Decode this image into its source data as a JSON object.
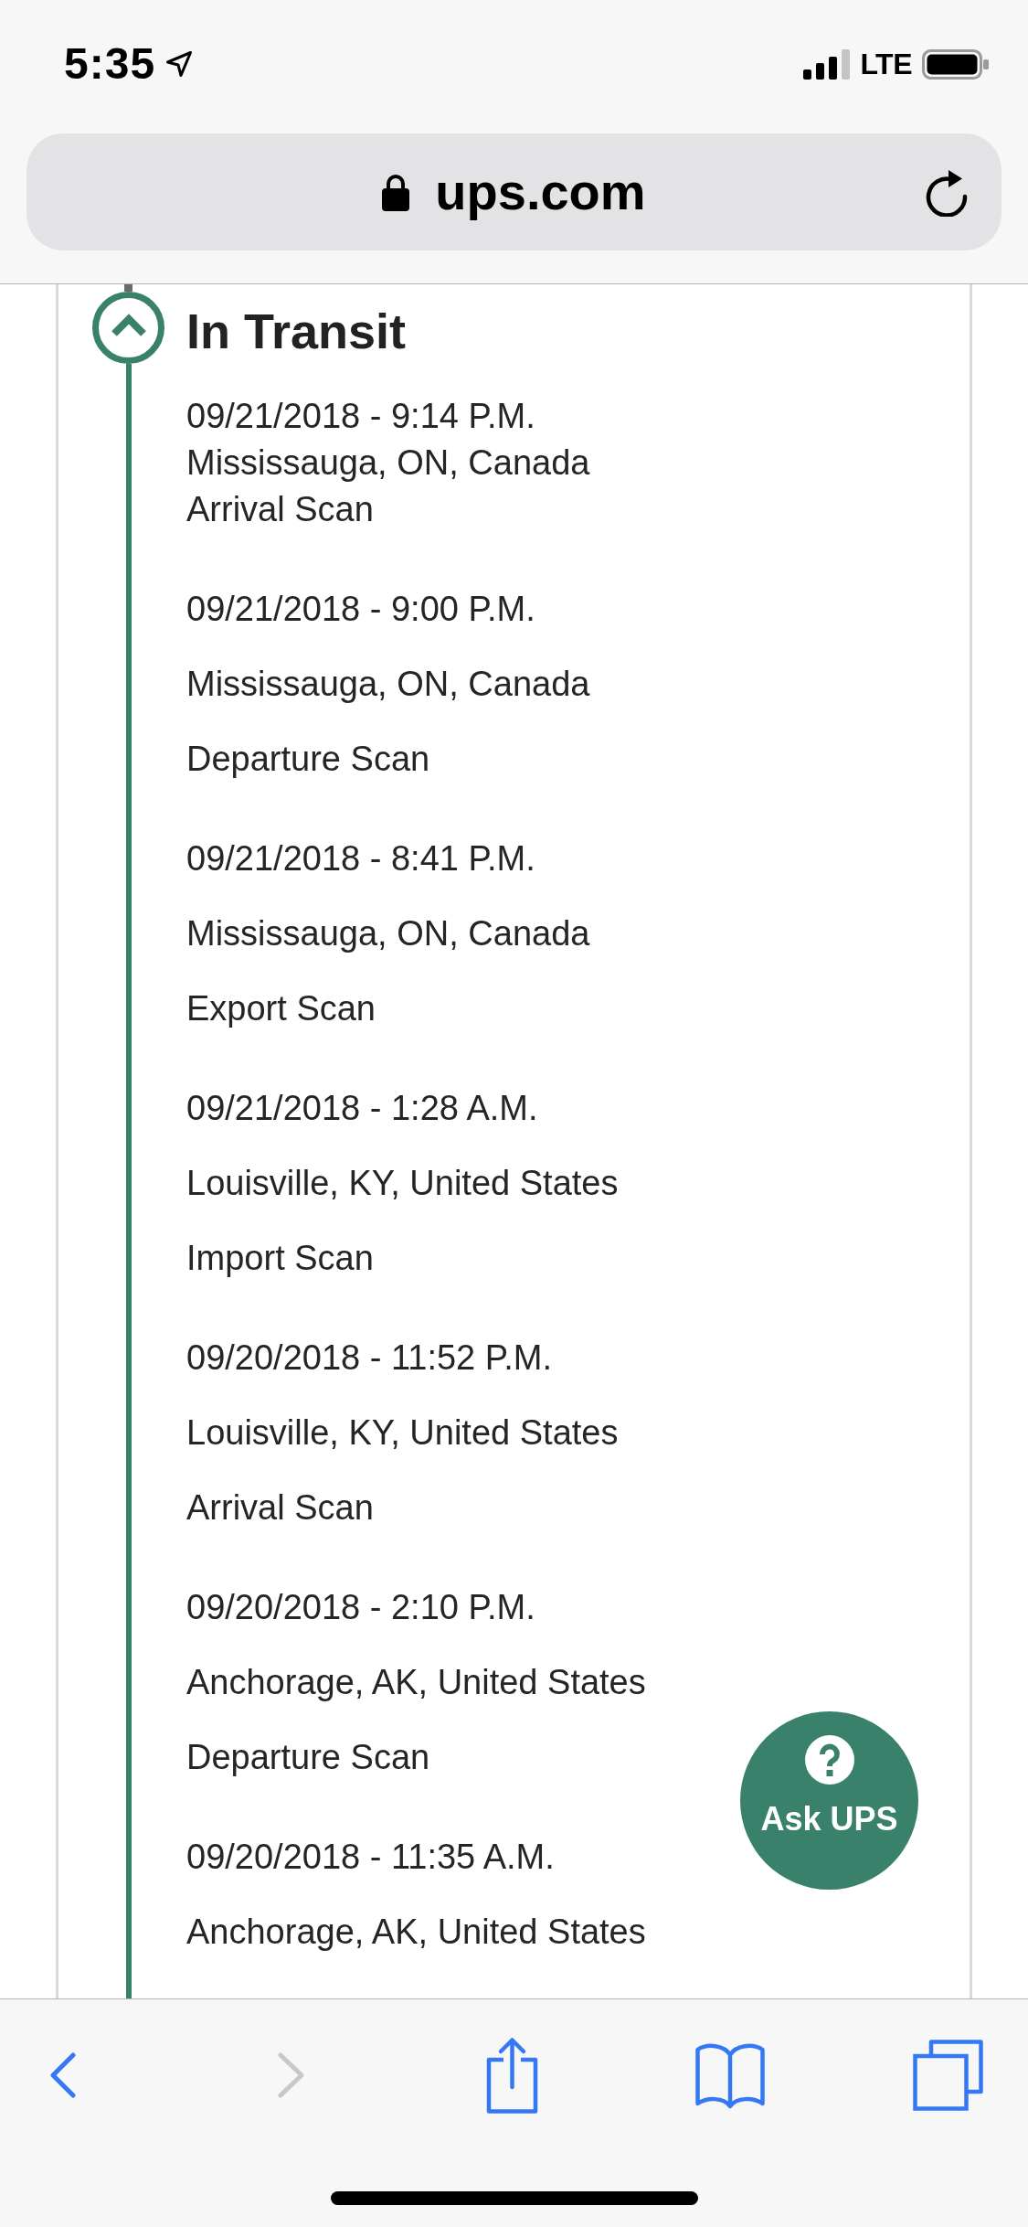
{
  "status_bar": {
    "time": "5:35",
    "network": "LTE"
  },
  "address_bar": {
    "url": "ups.com"
  },
  "tracking": {
    "section": {
      "title": "In Transit",
      "expanded": true
    },
    "events": [
      {
        "kind": "latest",
        "date": "09/21/2018 - 9:14 P.M.",
        "location": "Mississauga, ON, Canada",
        "activity": "Arrival Scan"
      },
      {
        "kind": "past",
        "date": "09/21/2018 - 9:00 P.M.",
        "location": "Mississauga, ON, Canada",
        "activity": "Departure Scan"
      },
      {
        "kind": "past",
        "date": "09/21/2018 - 8:41 P.M.",
        "location": "Mississauga, ON, Canada",
        "activity": "Export Scan"
      },
      {
        "kind": "past",
        "date": "09/21/2018 - 1:28 A.M.",
        "location": "Louisville, KY, United States",
        "activity": "Import Scan"
      },
      {
        "kind": "past",
        "date": "09/20/2018 - 11:52 P.M.",
        "location": "Louisville, KY, United States",
        "activity": "Arrival Scan"
      },
      {
        "kind": "past",
        "date": "09/20/2018 - 2:10 P.M.",
        "location": "Anchorage, AK, United States",
        "activity": "Departure Scan"
      },
      {
        "kind": "past",
        "date": "09/20/2018 - 11:35 A.M.",
        "location": "Anchorage, AK, United States"
      }
    ]
  },
  "help_button": {
    "label": "Ask UPS"
  },
  "toolbar": {
    "back": {
      "disabled": false
    },
    "forward": {
      "disabled": true
    }
  }
}
